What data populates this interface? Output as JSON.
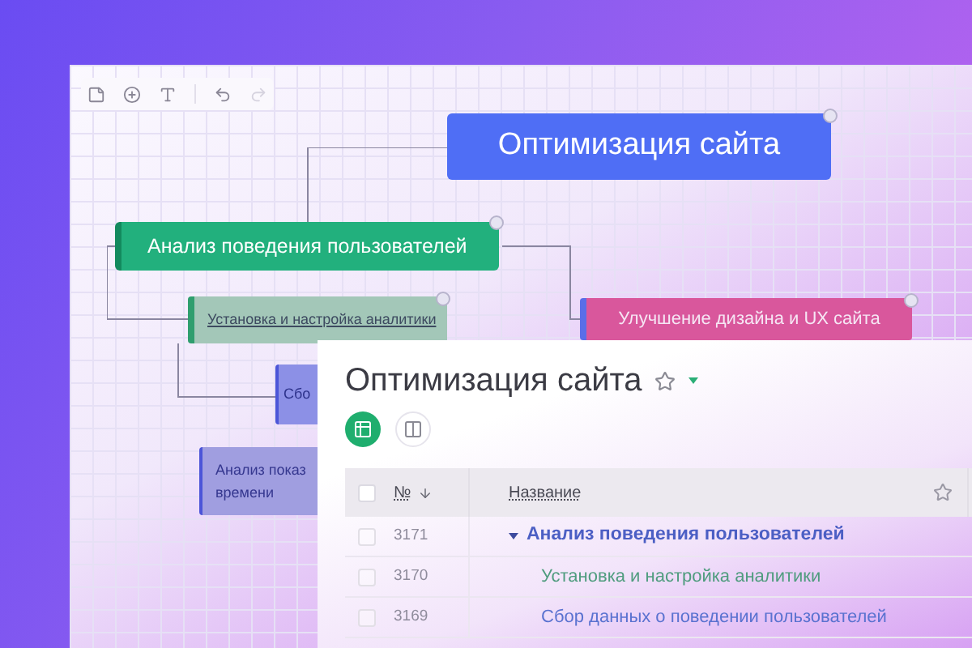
{
  "canvas": {
    "toolbar": [
      {
        "kind": "note",
        "disabled": false
      },
      {
        "kind": "add",
        "disabled": false
      },
      {
        "kind": "text",
        "disabled": false
      },
      {
        "kind": "undo",
        "disabled": false
      },
      {
        "kind": "redo",
        "disabled": true
      }
    ],
    "nodes": [
      {
        "text": "Оптимизация сайта",
        "color": "#4f6ef5"
      },
      {
        "text": "Анализ поведения пользователей",
        "color": "#22b07d"
      },
      {
        "text": "Установка и настройка аналитики",
        "color": "#a3c7b8"
      },
      {
        "text": "Улучшение дизайна и UX сайта",
        "color": "#d9579c"
      },
      {
        "text": "Сбо",
        "color": "#8c90e6"
      },
      {
        "text": "Анализ показ\nвремени",
        "color": "#a09ee0"
      }
    ]
  },
  "board": {
    "title": "Оптимизация сайта",
    "favorite": false,
    "views": [
      {
        "kind": "table",
        "selected": true
      },
      {
        "kind": "kanban",
        "selected": false
      }
    ],
    "columns": {
      "number": "№",
      "name": "Название",
      "all_checked": false
    },
    "rows": [
      {
        "number": "3171",
        "title": "Анализ поведения пользователей",
        "checked": false,
        "expanded": true,
        "children": [
          {
            "number": "3170",
            "title": "Установка и настройка аналитики",
            "checked": false
          },
          {
            "number": "3169",
            "title": "Сбор данных о поведении пользователей",
            "checked": false
          }
        ]
      }
    ]
  }
}
